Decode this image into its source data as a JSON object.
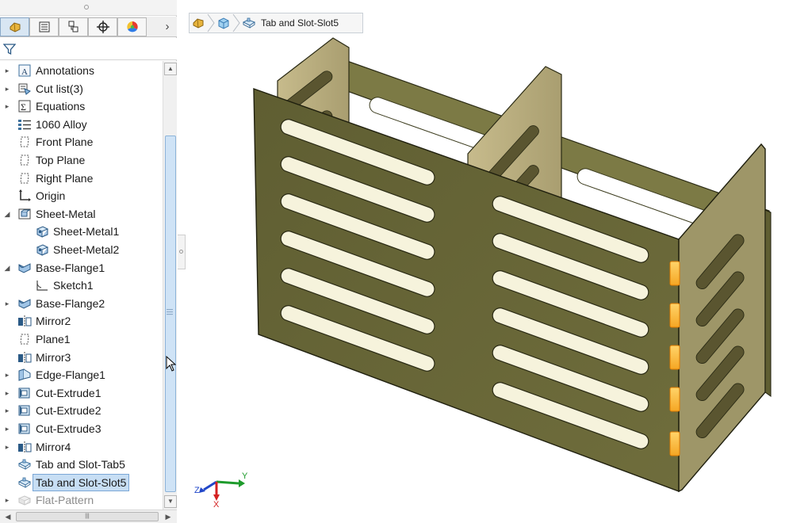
{
  "app": {
    "name": "SOLIDWORKS FeatureManager",
    "accent": "#7ba7d6",
    "model_color": "#6b6a3a"
  },
  "tabs": [
    {
      "name": "featuremanager-icon",
      "active": true
    },
    {
      "name": "propertymanager-icon",
      "active": false
    },
    {
      "name": "configurationmanager-icon",
      "active": false
    },
    {
      "name": "dimxpertmanager-icon",
      "active": false
    },
    {
      "name": "displaymanager-icon",
      "active": false
    }
  ],
  "tree": [
    {
      "label": "Annotations",
      "icon": "annotations-icon",
      "expander": "collapsed",
      "indent": 0
    },
    {
      "label": "Cut list(3)",
      "icon": "cut-list-icon",
      "expander": "collapsed",
      "indent": 0
    },
    {
      "label": "Equations",
      "icon": "equations-icon",
      "expander": "collapsed",
      "indent": 0
    },
    {
      "label": "1060 Alloy",
      "icon": "material-icon",
      "expander": "none",
      "indent": 0
    },
    {
      "label": "Front Plane",
      "icon": "plane-icon",
      "expander": "none",
      "indent": 0
    },
    {
      "label": "Top Plane",
      "icon": "plane-icon",
      "expander": "none",
      "indent": 0
    },
    {
      "label": "Right Plane",
      "icon": "plane-icon",
      "expander": "none",
      "indent": 0
    },
    {
      "label": "Origin",
      "icon": "origin-icon",
      "expander": "none",
      "indent": 0
    },
    {
      "label": "Sheet-Metal",
      "icon": "sheet-metal-folder-icon",
      "expander": "expanded",
      "indent": 0
    },
    {
      "label": "Sheet-Metal1",
      "icon": "sheet-metal-icon",
      "expander": "none",
      "indent": 1
    },
    {
      "label": "Sheet-Metal2",
      "icon": "sheet-metal-icon",
      "expander": "none",
      "indent": 1
    },
    {
      "label": "Base-Flange1",
      "icon": "base-flange-icon",
      "expander": "expanded",
      "indent": 0
    },
    {
      "label": "Sketch1",
      "icon": "sketch-icon",
      "expander": "none",
      "indent": 1
    },
    {
      "label": "Base-Flange2",
      "icon": "base-flange-icon",
      "expander": "collapsed",
      "indent": 0
    },
    {
      "label": "Mirror2",
      "icon": "mirror-icon",
      "expander": "none",
      "indent": 0
    },
    {
      "label": "Plane1",
      "icon": "plane-icon",
      "expander": "none",
      "indent": 0
    },
    {
      "label": "Mirror3",
      "icon": "mirror-icon",
      "expander": "none",
      "indent": 0
    },
    {
      "label": "Edge-Flange1",
      "icon": "edge-flange-icon",
      "expander": "collapsed",
      "indent": 0
    },
    {
      "label": "Cut-Extrude1",
      "icon": "cut-extrude-icon",
      "expander": "collapsed",
      "indent": 0
    },
    {
      "label": "Cut-Extrude2",
      "icon": "cut-extrude-icon",
      "expander": "collapsed",
      "indent": 0
    },
    {
      "label": "Cut-Extrude3",
      "icon": "cut-extrude-icon",
      "expander": "collapsed",
      "indent": 0
    },
    {
      "label": "Mirror4",
      "icon": "mirror-icon",
      "expander": "collapsed",
      "indent": 0
    },
    {
      "label": "Tab and Slot-Tab5",
      "icon": "tab-and-slot-icon",
      "expander": "none",
      "indent": 0
    },
    {
      "label": "Tab and Slot-Slot5",
      "icon": "tab-and-slot-icon",
      "expander": "none",
      "indent": 0,
      "selected": true
    },
    {
      "label": "Flat-Pattern",
      "icon": "flat-pattern-icon",
      "expander": "collapsed",
      "indent": 0,
      "dim": true
    }
  ],
  "breadcrumb": {
    "items": [
      "part-icon",
      "body-icon",
      "tab-and-slot-icon"
    ],
    "text": "Tab and Slot-Slot5"
  },
  "triad": {
    "x": "X",
    "y": "Y",
    "z": "Z"
  }
}
